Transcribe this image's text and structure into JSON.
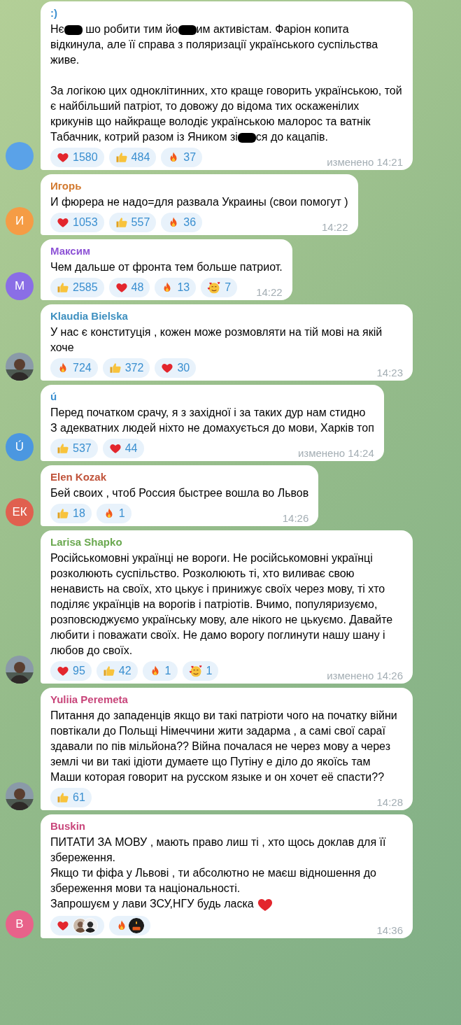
{
  "messages": [
    {
      "author": ":)",
      "color": "#3a8fd0",
      "avatar": {
        "kind": "initials",
        "color": "#5aa2e8"
      },
      "body": [
        {
          "spaced": false,
          "segments": [
            {
              "kind": "text",
              "text": "Нє"
            },
            {
              "kind": "redaction"
            },
            {
              "kind": "text",
              "text": " шо робити тим йо"
            },
            {
              "kind": "redaction"
            },
            {
              "kind": "text",
              "text": "им активістам. Фаріон копита відкинула, але її справа з поляризації українського суспільства живе."
            }
          ]
        },
        {
          "spaced": true,
          "segments": [
            {
              "kind": "text",
              "text": "За логікою цих одноклітинних, хто краще говорить українською, той є найбільший патріот, то довожу до відома тих оскаженілих крикунів що найкраще володіє українською малорос та ватнік Табачник, котрий разом із Яником зі"
            },
            {
              "kind": "redaction"
            },
            {
              "kind": "text",
              "text": "ся до кацапів."
            }
          ]
        }
      ],
      "reactions": [
        {
          "kind": "heart",
          "count": "1580"
        },
        {
          "kind": "like",
          "count": "484"
        },
        {
          "kind": "fire",
          "count": "37"
        }
      ],
      "time": "изменено 14:21"
    },
    {
      "author": "Игорь",
      "color": "#d2792f",
      "avatar": {
        "kind": "initials",
        "initials": "И",
        "color": "#f59c45"
      },
      "body": [
        {
          "spaced": false,
          "segments": [
            {
              "kind": "text",
              "text": "И фюрера не надо=для развала Украины (свои помогут )"
            }
          ]
        }
      ],
      "reactions": [
        {
          "kind": "heart",
          "count": "1053"
        },
        {
          "kind": "like",
          "count": "557"
        },
        {
          "kind": "fire",
          "count": "36"
        }
      ],
      "time": "14:22"
    },
    {
      "author": "Максим",
      "color": "#8e54d6",
      "avatar": {
        "kind": "initials",
        "initials": "М",
        "color": "#8a6ee6"
      },
      "body": [
        {
          "spaced": false,
          "segments": [
            {
              "kind": "text",
              "text": "Чем дальше от фронта тем больше патриот."
            }
          ]
        }
      ],
      "reactions": [
        {
          "kind": "like",
          "count": "2585"
        },
        {
          "kind": "heart",
          "count": "48"
        },
        {
          "kind": "fire",
          "count": "13"
        },
        {
          "kind": "love",
          "count": "7"
        }
      ],
      "time": "14:22"
    },
    {
      "author": "Klaudia Bielska",
      "color": "#3d8fbf",
      "avatar": {
        "kind": "picture"
      },
      "body": [
        {
          "spaced": false,
          "segments": [
            {
              "kind": "text",
              "text": "У нас є конституція , кожен може розмовляти на тій мові на якій хоче"
            }
          ]
        }
      ],
      "reactions": [
        {
          "kind": "fire",
          "count": "724"
        },
        {
          "kind": "like",
          "count": "372"
        },
        {
          "kind": "heart",
          "count": "30"
        }
      ],
      "time": "14:23"
    },
    {
      "author": "ú",
      "color": "#3a8fd0",
      "avatar": {
        "kind": "initials",
        "initials": "Ú",
        "color": "#4b97e0"
      },
      "body": [
        {
          "spaced": false,
          "segments": [
            {
              "kind": "text",
              "text": "Перед початком срачу, я з західної і за таких дур нам стидно"
            }
          ]
        },
        {
          "spaced": false,
          "segments": [
            {
              "kind": "text",
              "text": "З адекватних людей ніхто не домахується до мови, Харків топ"
            }
          ]
        }
      ],
      "reactions": [
        {
          "kind": "like",
          "count": "537"
        },
        {
          "kind": "heart",
          "count": "44"
        }
      ],
      "time": "изменено 14:24"
    },
    {
      "author": "Elen Kozak",
      "color": "#c0533a",
      "avatar": {
        "kind": "initials",
        "initials": "ЕК",
        "color": "#e0604f"
      },
      "body": [
        {
          "spaced": false,
          "segments": [
            {
              "kind": "text",
              "text": "Бей своих , чтоб Россия быстрее вошла во Львов"
            }
          ]
        }
      ],
      "reactions": [
        {
          "kind": "like",
          "count": "18"
        },
        {
          "kind": "fire",
          "count": "1"
        }
      ],
      "time": "14:26"
    },
    {
      "author": "Larisa Shapko",
      "color": "#6aa84f",
      "avatar": {
        "kind": "picture"
      },
      "body": [
        {
          "spaced": false,
          "segments": [
            {
              "kind": "text",
              "text": "Російськомовні українці не вороги. Не російськомовні українці розколюють суспільство. Розколюють ті, хто виливає свою ненависть на своїх, хто цькує і принижує своїх через мову, ті хто поділяє українців на ворогів і патріотів. Вчимо, популяризуємо, розповсюджуємо українську мову, але нікого не цькуємо. Давайте любити і поважати своїх. Не дамо ворогу поглинути нашу шану і любов до своїх."
            }
          ]
        }
      ],
      "reactions": [
        {
          "kind": "heart",
          "count": "95"
        },
        {
          "kind": "like",
          "count": "42"
        },
        {
          "kind": "fire",
          "count": "1"
        },
        {
          "kind": "love",
          "count": "1"
        }
      ],
      "time": "изменено 14:26"
    },
    {
      "author": "Yuliia Peremeta",
      "color": "#c8457a",
      "avatar": {
        "kind": "picture"
      },
      "body": [
        {
          "spaced": false,
          "segments": [
            {
              "kind": "text",
              "text": "Питання до западенців якщо ви такі патріоти чого на початку війни повтікали до Польщі Німеччини жити задарма ,  а самі свої сараї здавали по пів мільйона??  Війна почалася не через мову а через землі чи ви такі ідіоти думаете що Путіну е діло до якоїсь там Маши которая говорит на русском языке и он хочет её спасти??"
            }
          ]
        }
      ],
      "reactions": [
        {
          "kind": "like",
          "count": "61"
        }
      ],
      "time": "14:28"
    },
    {
      "author": "Buskin",
      "color": "#c8457a",
      "avatar": {
        "kind": "initials",
        "initials": "B",
        "color": "#e8628a"
      },
      "body": [
        {
          "spaced": false,
          "segments": [
            {
              "kind": "text",
              "text": "ПИТАТИ ЗА МОВУ , мають право лиш ті , хто щось доклав для її збереження."
            }
          ]
        },
        {
          "spaced": false,
          "segments": [
            {
              "kind": "text",
              "text": "Якщо ти фіфа у Львові , ти абсолютно не маєш відношення до збереження мови та національності."
            }
          ]
        },
        {
          "spaced": false,
          "segments": [
            {
              "kind": "text",
              "text": "Запрошуєм у лави ЗСУ,НГУ будь ласка "
            },
            {
              "kind": "heart"
            }
          ]
        }
      ],
      "reactions": [
        {
          "kind": "heart",
          "users": [
            {
              "kind": "picture"
            },
            {
              "kind": "picture"
            }
          ]
        },
        {
          "kind": "fire",
          "users": [
            {
              "kind": "candle"
            }
          ]
        }
      ],
      "time": "14:36"
    }
  ]
}
